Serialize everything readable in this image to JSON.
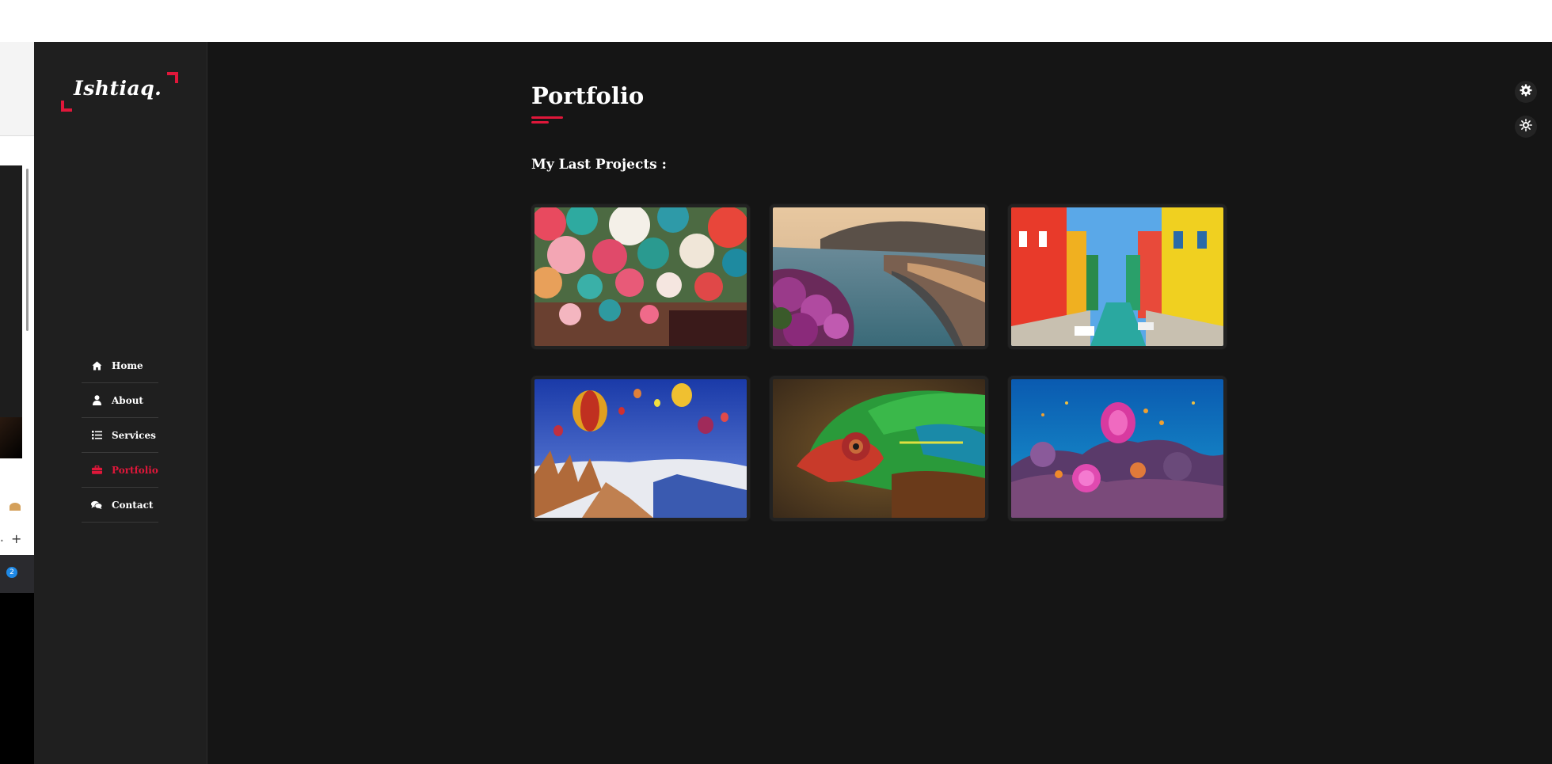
{
  "brand": {
    "logo_text": "Ishtiaq.",
    "accent_color": "#e0173a"
  },
  "nav": {
    "items": [
      {
        "label": "Home",
        "icon": "home-icon",
        "active": false
      },
      {
        "label": "About",
        "icon": "user-icon",
        "active": false
      },
      {
        "label": "Services",
        "icon": "list-icon",
        "active": false
      },
      {
        "label": "Portfolio",
        "icon": "briefcase-icon",
        "active": true
      },
      {
        "label": "Contact",
        "icon": "comments-icon",
        "active": false
      }
    ]
  },
  "page": {
    "title": "Portfolio",
    "subtitle": "My Last Projects :"
  },
  "portfolio": {
    "items": [
      {
        "subject": "umbrellas",
        "icon": "project-image"
      },
      {
        "subject": "coastal-town",
        "icon": "project-image"
      },
      {
        "subject": "colorful-canal",
        "icon": "project-image"
      },
      {
        "subject": "hot-air-balloons",
        "icon": "project-image"
      },
      {
        "subject": "chameleon",
        "icon": "project-image"
      },
      {
        "subject": "coral-reef",
        "icon": "project-image"
      }
    ]
  },
  "tools": {
    "settings_icon": "gear-icon",
    "theme_icon": "sun-icon"
  },
  "background_window": {
    "badge": "2",
    "plus": "+"
  }
}
